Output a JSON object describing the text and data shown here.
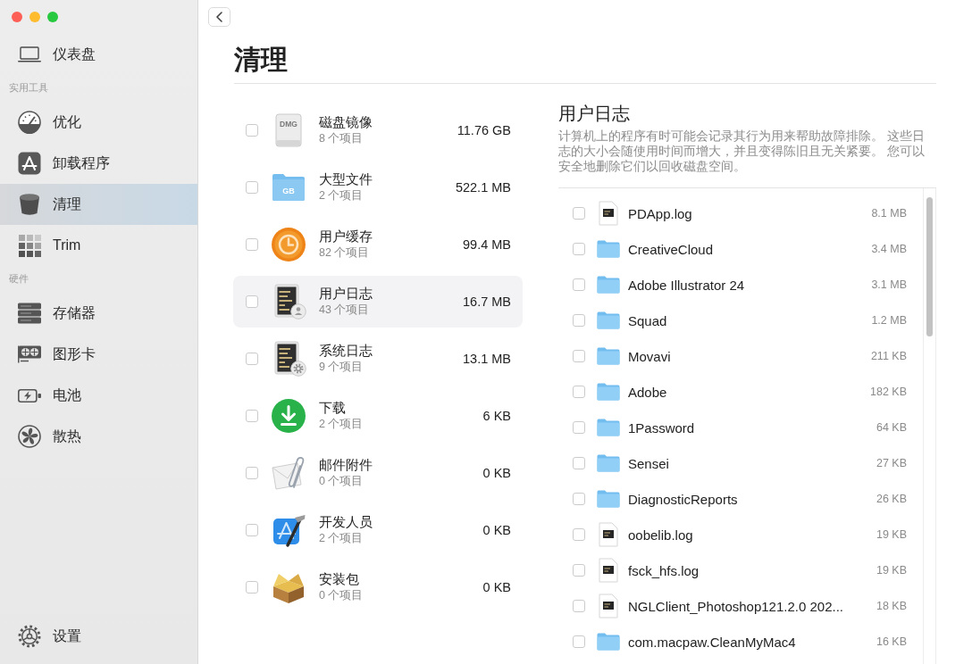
{
  "sidebar": {
    "top_item": {
      "label": "仪表盘",
      "kind": "laptop",
      "selected": false
    },
    "sections": [
      {
        "heading": "实用工具",
        "items": [
          {
            "label": "优化",
            "kind": "gauge",
            "selected": false
          },
          {
            "label": "卸载程序",
            "kind": "atile",
            "selected": false
          },
          {
            "label": "清理",
            "kind": "bin",
            "selected": true
          },
          {
            "label": "Trim",
            "kind": "grid",
            "selected": false
          }
        ]
      },
      {
        "heading": "硬件",
        "items": [
          {
            "label": "存储器",
            "kind": "drives",
            "selected": false
          },
          {
            "label": "图形卡",
            "kind": "gpu",
            "selected": false
          },
          {
            "label": "电池",
            "kind": "battery",
            "selected": false
          },
          {
            "label": "散热",
            "kind": "fan",
            "selected": false
          }
        ]
      }
    ],
    "settings": {
      "label": "设置",
      "kind": "gear",
      "selected": false
    }
  },
  "page": {
    "title": "清理"
  },
  "categories": [
    {
      "name": "磁盘镜像",
      "count": "8 个项目",
      "size": "11.76 GB",
      "kind": "dmg",
      "icon_label": "DMG",
      "checked": false,
      "selected": false
    },
    {
      "name": "大型文件",
      "count": "2 个项目",
      "size": "522.1 MB",
      "kind": "folder",
      "icon_label": "GB",
      "checked": false,
      "selected": false
    },
    {
      "name": "用户缓存",
      "count": "82 个项目",
      "size": "99.4 MB",
      "kind": "clock",
      "checked": false,
      "selected": false
    },
    {
      "name": "用户日志",
      "count": "43 个项目",
      "size": "16.7 MB",
      "kind": "userlog",
      "checked": false,
      "selected": true
    },
    {
      "name": "系统日志",
      "count": "9 个项目",
      "size": "13.1 MB",
      "kind": "syslog",
      "checked": false,
      "selected": false
    },
    {
      "name": "下载",
      "count": "2 个项目",
      "size": "6 KB",
      "kind": "download",
      "checked": false,
      "selected": false
    },
    {
      "name": "邮件附件",
      "count": "0 个项目",
      "size": "0 KB",
      "kind": "mail",
      "checked": false,
      "selected": false
    },
    {
      "name": "开发人员",
      "count": "2 个项目",
      "size": "0 KB",
      "kind": "devtool",
      "checked": false,
      "selected": false
    },
    {
      "name": "安装包",
      "count": "0 个项目",
      "size": "0 KB",
      "kind": "package",
      "checked": false,
      "selected": false
    }
  ],
  "detail": {
    "title": "用户日志",
    "description": "计算机上的程序有时可能会记录其行为用来帮助故障排除。 这些日志的大小会随使用时间而增大，并且变得陈旧且无关紧要。 您可以安全地删除它们以回收磁盘空间。",
    "files": [
      {
        "name": "PDApp.log",
        "size": "8.1 MB",
        "kind": "log",
        "checked": false
      },
      {
        "name": "CreativeCloud",
        "size": "3.4 MB",
        "kind": "folder",
        "checked": false
      },
      {
        "name": "Adobe Illustrator 24",
        "size": "3.1 MB",
        "kind": "folder",
        "checked": false
      },
      {
        "name": "Squad",
        "size": "1.2 MB",
        "kind": "folder",
        "checked": false
      },
      {
        "name": "Movavi",
        "size": "211 KB",
        "kind": "folder",
        "checked": false
      },
      {
        "name": "Adobe",
        "size": "182 KB",
        "kind": "folder",
        "checked": false
      },
      {
        "name": "1Password",
        "size": "64 KB",
        "kind": "folder",
        "checked": false
      },
      {
        "name": "Sensei",
        "size": "27 KB",
        "kind": "folder",
        "checked": false
      },
      {
        "name": "DiagnosticReports",
        "size": "26 KB",
        "kind": "folder",
        "checked": false
      },
      {
        "name": "oobelib.log",
        "size": "19 KB",
        "kind": "log",
        "checked": false
      },
      {
        "name": "fsck_hfs.log",
        "size": "19 KB",
        "kind": "log",
        "checked": false
      },
      {
        "name": "NGLClient_Photoshop121.2.0 202...",
        "size": "18 KB",
        "kind": "log",
        "checked": false
      },
      {
        "name": "com.macpaw.CleanMyMac4",
        "size": "16 KB",
        "kind": "folder",
        "checked": false
      }
    ]
  }
}
